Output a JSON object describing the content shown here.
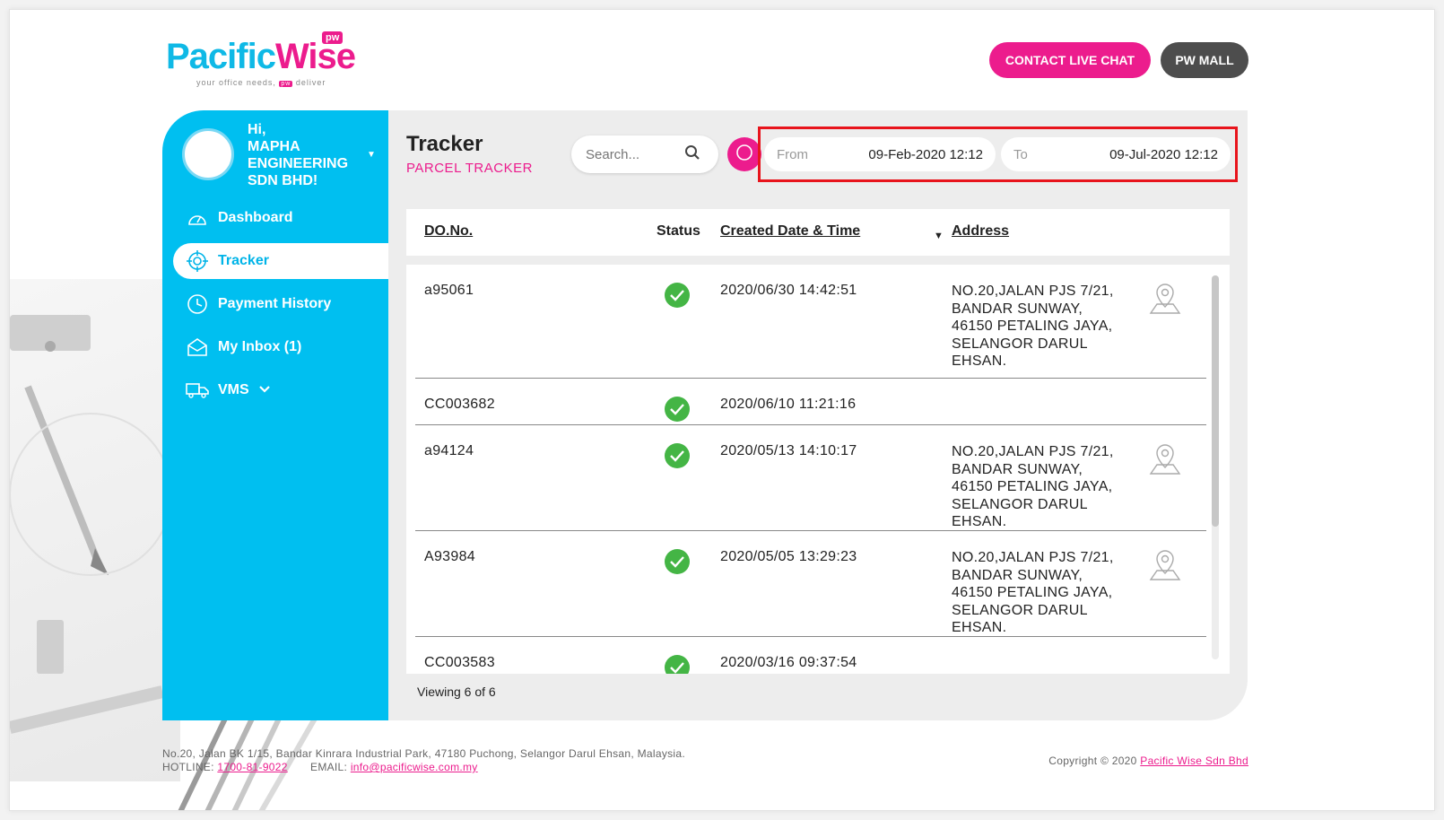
{
  "brand": {
    "logo_part1": "Pac",
    "logo_part1b": "ific",
    "logo_part2": "Wise",
    "badge": "pw",
    "tag_left": "your office needs,",
    "tag_mini": "pw",
    "tag_right": "deliver"
  },
  "header": {
    "contact_label": "CONTACT LIVE CHAT",
    "mall_label": "PW MALL"
  },
  "user": {
    "greeting": "Hi,",
    "name": "MAPHA ENGINEERING SDN BHD!"
  },
  "sidebar": {
    "items": [
      {
        "label": "Dashboard",
        "icon": "gauge-icon"
      },
      {
        "label": "Tracker",
        "icon": "crosshair-icon"
      },
      {
        "label": "Payment History",
        "icon": "clock-icon"
      },
      {
        "label": "My Inbox (1)",
        "icon": "envelope-icon"
      },
      {
        "label": "VMS",
        "icon": "truck-icon"
      }
    ]
  },
  "page": {
    "title": "Tracker",
    "subtitle": "PARCEL TRACKER"
  },
  "search": {
    "placeholder": "Search..."
  },
  "date_range": {
    "from_label": "From",
    "from_value": "09-Feb-2020 12:12",
    "to_label": "To",
    "to_value": "09-Jul-2020 12:12"
  },
  "table": {
    "columns": [
      "DO.No.",
      "Status",
      "Created Date & Time",
      "Address"
    ],
    "rows": [
      {
        "do": "a95061",
        "status": "delivered",
        "datetime": "2020/06/30 14:42:51",
        "address": [
          "NO.20,JALAN PJS 7/21,",
          "BANDAR SUNWAY,",
          "46150 PETALING JAYA,",
          "SELANGOR DARUL",
          "EHSAN."
        ]
      },
      {
        "do": "CC003682",
        "status": "delivered",
        "datetime": "2020/06/10 11:21:16",
        "address": []
      },
      {
        "do": "a94124",
        "status": "delivered",
        "datetime": "2020/05/13 14:10:17",
        "address": [
          "NO.20,JALAN PJS 7/21,",
          "BANDAR SUNWAY,",
          "46150 PETALING JAYA,",
          "SELANGOR DARUL",
          "EHSAN."
        ]
      },
      {
        "do": "A93984",
        "status": "delivered",
        "datetime": "2020/05/05 13:29:23",
        "address": [
          "NO.20,JALAN PJS 7/21,",
          "BANDAR SUNWAY,",
          "46150 PETALING JAYA,",
          "SELANGOR DARUL",
          "EHSAN."
        ]
      },
      {
        "do": "CC003583",
        "status": "delivered",
        "datetime": "2020/03/16 09:37:54",
        "address": []
      }
    ],
    "viewing": "Viewing 6 of 6"
  },
  "footer": {
    "address": "No.20, Jalan BK 1/15, Bandar Kinrara Industrial Park, 47180 Puchong, Selangor Darul Ehsan, Malaysia.",
    "hotline_label": "HOTLINE:",
    "hotline": "1700-81-9022",
    "email_label": "EMAIL:",
    "email": "info@pacificwise.com.my",
    "copyright": "Copyright © 2020",
    "company": "Pacific Wise Sdn Bhd"
  },
  "colors": {
    "brand_blue": "#00bff0",
    "brand_pink": "#ec1c8d",
    "status_green": "#44b545",
    "highlight_red": "#e8141c"
  }
}
